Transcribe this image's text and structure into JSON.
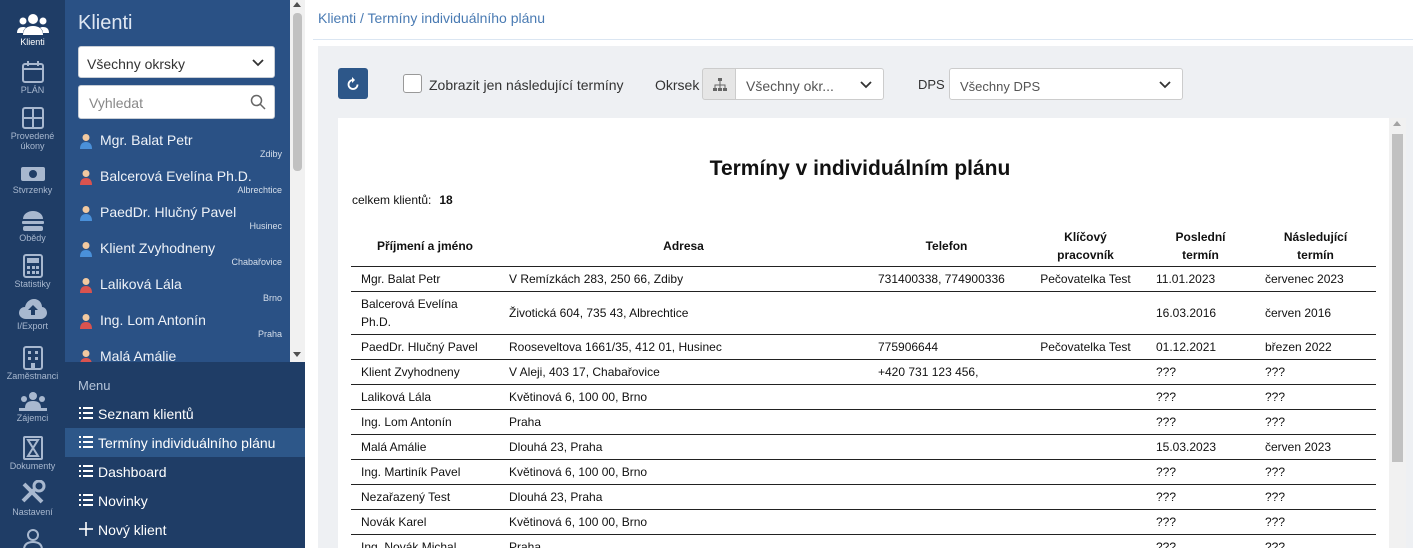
{
  "rail": [
    {
      "label": "Klienti",
      "icon": "users-icon",
      "active": true
    },
    {
      "label": "PLÁN",
      "icon": "calendar-icon"
    },
    {
      "label": "Provedené úkony",
      "icon": "grid-icon"
    },
    {
      "label": "Stvrzenky",
      "icon": "banknote-icon"
    },
    {
      "label": "Obědy",
      "icon": "burger-icon"
    },
    {
      "label": "Statistiky",
      "icon": "calculator-icon"
    },
    {
      "label": "I/Export",
      "icon": "cloud-upload-icon"
    },
    {
      "label": "Zaměstnanci",
      "icon": "building-icon"
    },
    {
      "label": "Zájemci",
      "icon": "group-icon"
    },
    {
      "label": "Dokumenty",
      "icon": "hourglass-icon"
    },
    {
      "label": "Nastavení",
      "icon": "tools-icon"
    }
  ],
  "sidebar": {
    "title": "Klienti",
    "district_select": "Všechny okrsky",
    "search_placeholder": "Vyhledat",
    "clients": [
      {
        "name": "Mgr. Balat Petr",
        "town": "Zdiby"
      },
      {
        "name": "Balcerová Evelína Ph.D.",
        "town": "Albrechtice"
      },
      {
        "name": "PaedDr. Hlučný Pavel",
        "town": "Husinec"
      },
      {
        "name": "Klient Zvyhodneny",
        "town": "Chabařovice"
      },
      {
        "name": "Laliková Lála",
        "town": "Brno"
      },
      {
        "name": "Ing. Lom Antonín",
        "town": "Praha"
      },
      {
        "name": "Malá Amálie",
        "town": ""
      }
    ],
    "menu_title": "Menu",
    "menu": [
      {
        "label": "Seznam klientů",
        "icon": "list-icon"
      },
      {
        "label": "Termíny individuálního plánu",
        "icon": "list-icon",
        "active": true
      },
      {
        "label": "Dashboard",
        "icon": "list-icon"
      },
      {
        "label": "Novinky",
        "icon": "list-icon"
      },
      {
        "label": "Nový klient",
        "icon": "plus-icon"
      }
    ]
  },
  "breadcrumb": "Klienti / Termíny individuálního plánu",
  "toolbar": {
    "checkbox_label": "Zobrazit jen následující termíny",
    "okrsek_label": "Okrsek",
    "okrsek_value": "Všechny okr...",
    "dps_label": "DPS",
    "dps_value": "Všechny DPS"
  },
  "report": {
    "title": "Termíny v individuálním plánu",
    "total_label": "celkem klientů:",
    "total_value": "18",
    "headers": {
      "name": "Příjmení a jméno",
      "address": "Adresa",
      "phone": "Telefon",
      "worker_l1": "Klíčový",
      "worker_l2": "pracovník",
      "last_l1": "Poslední",
      "last_l2": "termín",
      "next_l1": "Následující",
      "next_l2": "termín"
    },
    "rows": [
      {
        "name": "Mgr. Balat Petr",
        "address": "V Remízkách 283, 250 66, Zdiby",
        "phone": "731400338, 774900336",
        "worker": "Pečovatelka Test",
        "last": "11.01.2023",
        "next": "červenec 2023"
      },
      {
        "name": "Balcerová Evelína Ph.D.",
        "address": "Životická 604, 735 43, Albrechtice",
        "phone": "",
        "worker": "",
        "last": "16.03.2016",
        "next": "červen 2016"
      },
      {
        "name": "PaedDr. Hlučný Pavel",
        "address": "Rooseveltova 1661/35, 412 01, Husinec",
        "phone": "775906644",
        "worker": "Pečovatelka Test",
        "last": "01.12.2021",
        "next": "březen 2022"
      },
      {
        "name": "Klient Zvyhodneny",
        "address": "V Aleji, 403 17, Chabařovice",
        "phone": "+420 731 123 456,",
        "worker": "",
        "last": "???",
        "next": "???"
      },
      {
        "name": "Laliková Lála",
        "address": "Květinová 6, 100 00, Brno",
        "phone": "",
        "worker": "",
        "last": "???",
        "next": "???"
      },
      {
        "name": "Ing. Lom Antonín",
        "address": "Praha",
        "phone": "",
        "worker": "",
        "last": "???",
        "next": "???"
      },
      {
        "name": "Malá Amálie",
        "address": "Dlouhá 23, Praha",
        "phone": "",
        "worker": "",
        "last": "15.03.2023",
        "next": "červen 2023"
      },
      {
        "name": "Ing. Martiník Pavel",
        "address": "Květinová 6, 100 00, Brno",
        "phone": "",
        "worker": "",
        "last": "???",
        "next": "???"
      },
      {
        "name": "Nezařazený Test",
        "address": "Dlouhá 23, Praha",
        "phone": "",
        "worker": "",
        "last": "???",
        "next": "???"
      },
      {
        "name": "Novák Karel",
        "address": "Květinová 6, 100 00, Brno",
        "phone": "",
        "worker": "",
        "last": "???",
        "next": "???"
      },
      {
        "name": "Ing. Novák Michal",
        "address": "Praha",
        "phone": "",
        "worker": "",
        "last": "???",
        "next": "???"
      }
    ]
  }
}
